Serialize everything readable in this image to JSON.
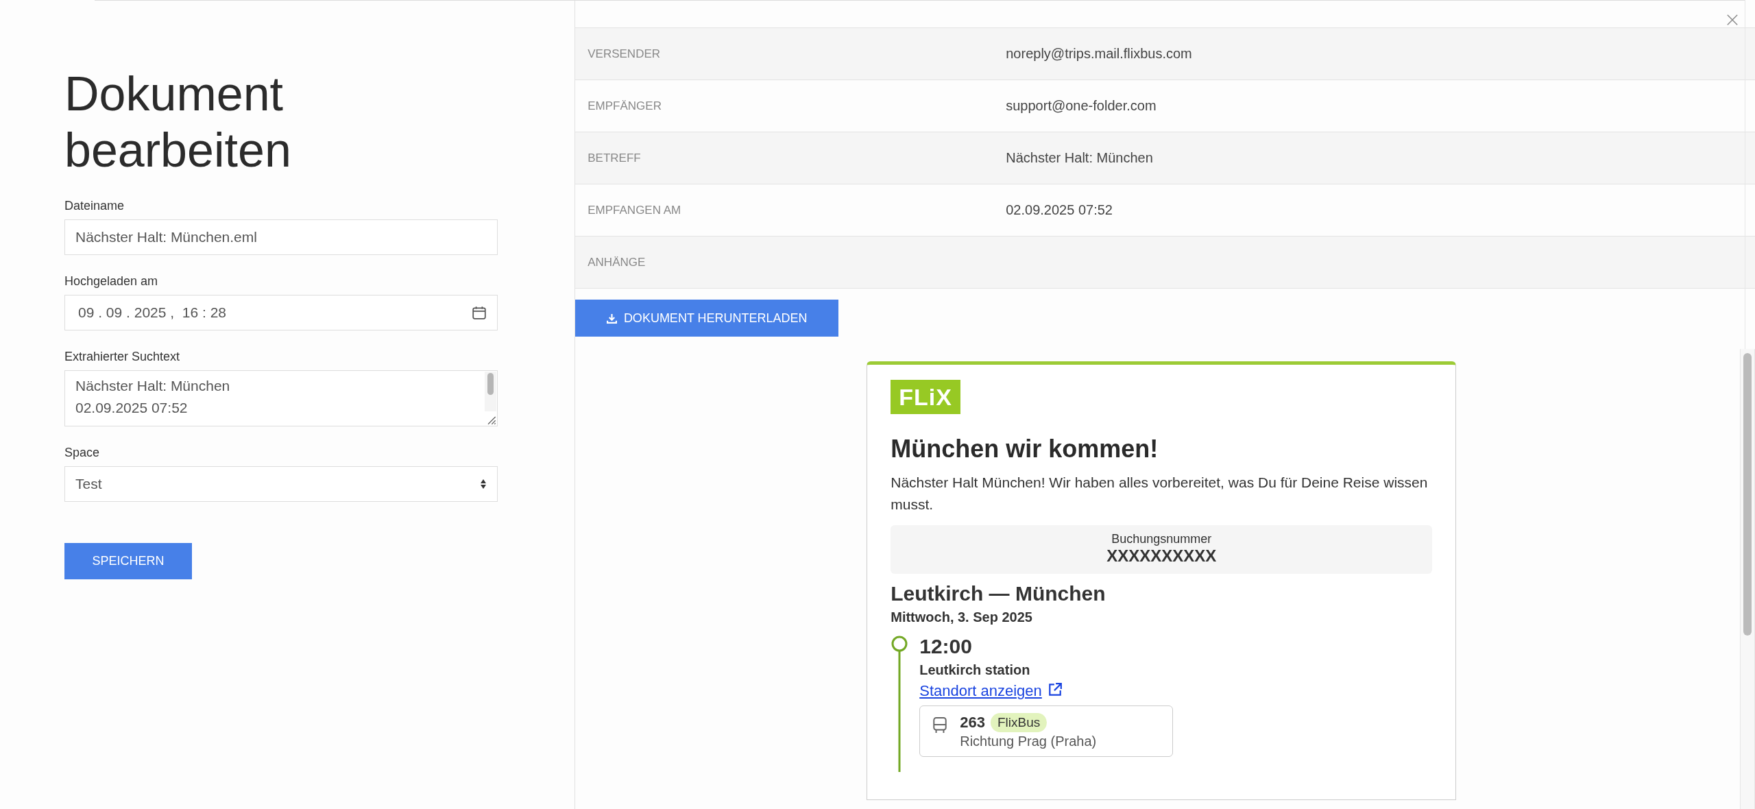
{
  "form": {
    "title": "Dokument bearbeiten",
    "fields": [
      {
        "kind": "text",
        "label": "Dateiname",
        "value": "Nächster Halt: München.eml"
      },
      {
        "kind": "datetime",
        "label": "Hochgeladen am",
        "value": "09 . 09 . 2025 ,  16 : 28"
      },
      {
        "kind": "textarea",
        "label": "Extrahierter Suchtext",
        "lines": [
          "Nächster Halt: München",
          "02.09.2025 07:52"
        ]
      },
      {
        "kind": "select",
        "label": "Space",
        "value": "Test"
      }
    ],
    "save_button": "SPEICHERN"
  },
  "metadata": {
    "rows": [
      {
        "label": "VERSENDER",
        "value": "noreply@trips.mail.flixbus.com"
      },
      {
        "label": "EMPFÄNGER",
        "value": "support@one-folder.com"
      },
      {
        "label": "BETREFF",
        "value": "Nächster Halt: München"
      },
      {
        "label": "EMPFANGEN AM",
        "value": "02.09.2025 07:52"
      },
      {
        "label": "ANHÄNGE"
      }
    ]
  },
  "download_button": "DOKUMENT HERUNTERLADEN",
  "email_preview": {
    "logo": "FLiX",
    "heading": "München wir kommen!",
    "intro": "Nächster Halt München! Wir haben alles vorbereitet, was Du für Deine Reise wissen musst.",
    "booking": {
      "label": "Buchungsnummer",
      "number": "XXXXXXXXXX"
    },
    "trip": {
      "route": "Leutkirch — München",
      "date": "Mittwoch, 3. Sep 2025",
      "stops": [
        {
          "time": "12:00",
          "station": "Leutkirch station",
          "link": "Standort anzeigen",
          "ride": {
            "number": "263",
            "operator": "FlixBus",
            "direction": "Richtung Prag (Praha)"
          }
        }
      ]
    }
  }
}
